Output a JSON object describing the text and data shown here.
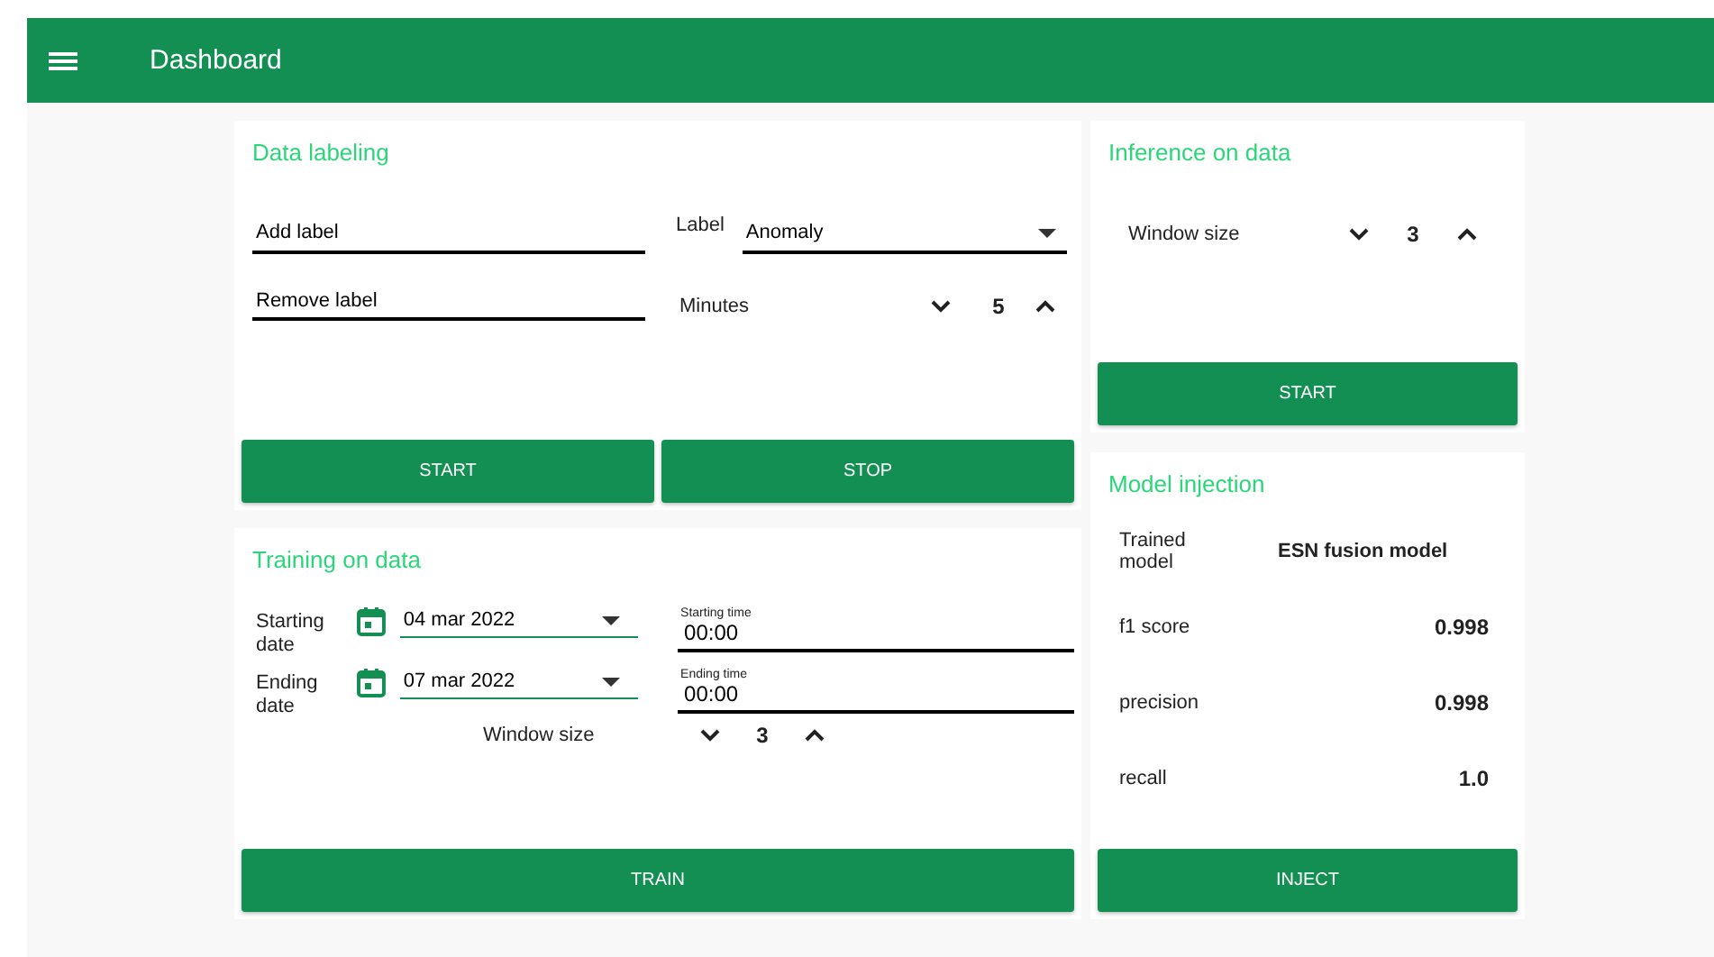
{
  "app_bar": {
    "title": "Dashboard"
  },
  "data_labeling": {
    "title": "Data labeling",
    "add_label": {
      "value": "Add label"
    },
    "remove_label": {
      "value": "Remove label"
    },
    "label_select": {
      "label": "Label",
      "value": "Anomaly"
    },
    "minutes": {
      "label": "Minutes",
      "value": "5"
    },
    "buttons": [
      "START",
      "STOP"
    ]
  },
  "training": {
    "title": "Training on data",
    "rows": [
      {
        "label": "Starting date",
        "date": "04 mar 2022",
        "time_label": "Starting time",
        "time": "00:00"
      },
      {
        "label": "Ending date",
        "date": "07 mar 2022",
        "time_label": "Ending time",
        "time": "00:00"
      }
    ],
    "window_size": {
      "label": "Window size",
      "value": "3"
    },
    "button": "TRAIN"
  },
  "inference": {
    "title": "Inference on data",
    "window_size": {
      "label": "Window size",
      "value": "3"
    },
    "button": "START"
  },
  "model_injection": {
    "title": "Model injection",
    "rows": [
      {
        "kind": "text",
        "label": "Trained model",
        "value": "ESN fusion model"
      },
      {
        "kind": "metric",
        "label": "f1 score",
        "value": "0.998"
      },
      {
        "kind": "metric",
        "label": "precision",
        "value": "0.998"
      },
      {
        "kind": "metric",
        "label": "recall",
        "value": "1.0"
      }
    ],
    "button": "INJECT"
  }
}
